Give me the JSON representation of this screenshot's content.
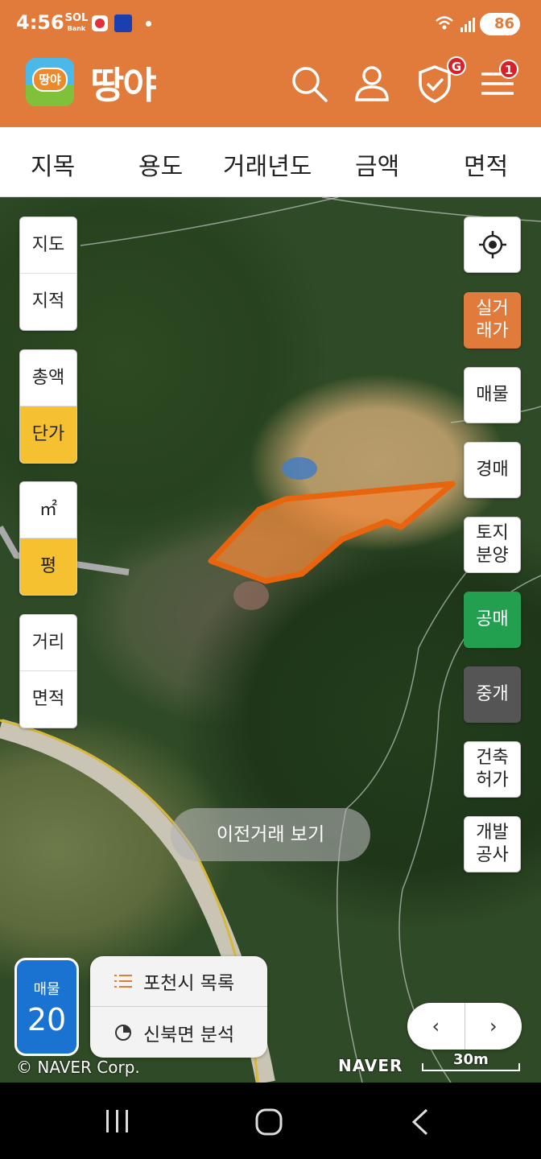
{
  "status": {
    "time": "4:56",
    "battery": "86",
    "sol_label": "SOL",
    "sol_sub": "Bank"
  },
  "header": {
    "brand": "땅야",
    "logo_text": "땅야",
    "shield_badge": "G",
    "menu_badge": "1"
  },
  "filters": [
    "지목",
    "용도",
    "거래년도",
    "금액",
    "면적"
  ],
  "left_controls": {
    "map_type": [
      "지도",
      "지적"
    ],
    "price_mode": [
      "총액",
      "단가"
    ],
    "unit": [
      "㎡",
      "평"
    ],
    "measure": [
      "거리",
      "면적"
    ]
  },
  "right_controls": {
    "real_trade": "실거\n래가",
    "listing": "매물",
    "auction": "경매",
    "land_sale": "토지\n분양",
    "public_sale": "공매",
    "brokerage": "중개",
    "building_permit": "건축\n허가",
    "development": "개발\n공사"
  },
  "prev_trade_button": "이전거래 보기",
  "listing_count": {
    "label": "매물",
    "value": "20"
  },
  "list_panel": {
    "city_list": "포천시 목록",
    "area_analysis": "신북면 분석"
  },
  "pager": {
    "prev": "‹",
    "next": "›"
  },
  "map_footer": {
    "copyright": "© NAVER Corp.",
    "naver": "NAVER",
    "scale": "30m"
  },
  "colors": {
    "brand_orange": "#e07b3c",
    "active_yellow": "#f6c131",
    "green": "#22a050",
    "count_blue": "#1a73d0",
    "parcel_fill": "#f08a3c"
  }
}
